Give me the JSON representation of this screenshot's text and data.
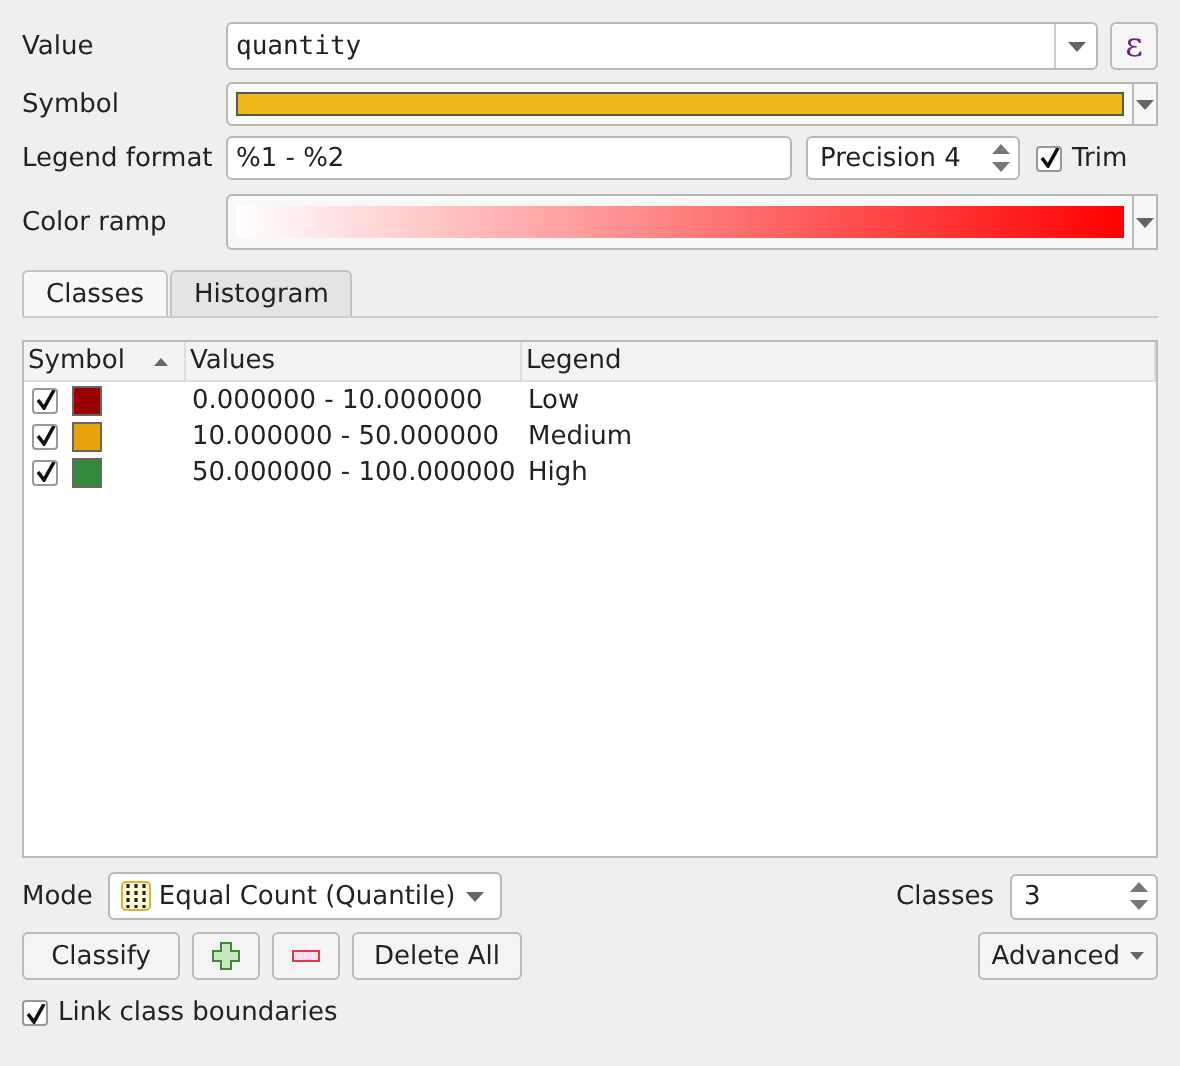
{
  "value": {
    "label": "Value",
    "field": "quantity",
    "expression_button": "ε"
  },
  "symbol": {
    "label": "Symbol",
    "color": "#f0b71b"
  },
  "legend_format": {
    "label": "Legend format",
    "value": "%1 - %2",
    "precision": "Precision 4",
    "trim": {
      "label": "Trim",
      "checked": true
    }
  },
  "color_ramp": {
    "label": "Color ramp",
    "color": "#ff0000"
  },
  "tabs": [
    {
      "label": "Classes",
      "selected": true
    },
    {
      "label": "Histogram",
      "selected": false
    }
  ],
  "table": {
    "columns": [
      "Symbol",
      "Values",
      "Legend"
    ],
    "rows": [
      {
        "checked": true,
        "color": "#990000",
        "values": "0.000000 - 10.000000",
        "legend": "Low"
      },
      {
        "checked": true,
        "color": "#e8a20c",
        "values": "10.000000 - 50.000000",
        "legend": "Medium"
      },
      {
        "checked": true,
        "color": "#33883a",
        "values": "50.000000 - 100.000000",
        "legend": "High"
      }
    ]
  },
  "mode": {
    "label": "Mode",
    "value": "Equal Count (Quantile)"
  },
  "classes": {
    "label": "Classes",
    "value": "3"
  },
  "buttons": {
    "classify": "Classify",
    "delete_all": "Delete All",
    "advanced": "Advanced"
  },
  "link_boundaries": {
    "label": "Link class boundaries",
    "checked": true
  }
}
